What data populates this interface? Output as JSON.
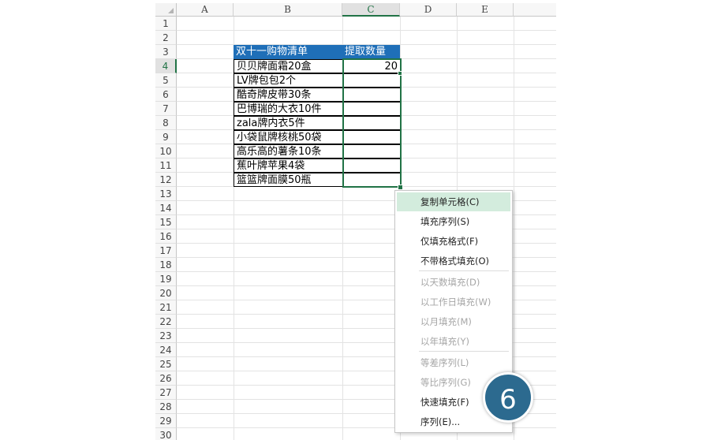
{
  "columns": [
    "A",
    "B",
    "C",
    "D",
    "E"
  ],
  "selected_column": "C",
  "selected_row": "4",
  "row_numbers": [
    "1",
    "2",
    "3",
    "4",
    "5",
    "6",
    "7",
    "8",
    "9",
    "10",
    "11",
    "12",
    "13",
    "14",
    "15",
    "16",
    "17",
    "18",
    "19",
    "20",
    "21",
    "22",
    "23",
    "24",
    "25",
    "26",
    "27",
    "28",
    "29",
    "30"
  ],
  "table": {
    "header_item": "双十一购物清单",
    "header_qty": "提取数量",
    "items": [
      {
        "name": "贝贝牌面霜20盒",
        "qty": "20"
      },
      {
        "name": "LV牌包包2个",
        "qty": ""
      },
      {
        "name": "酷奇牌皮带30条",
        "qty": ""
      },
      {
        "name": "巴博瑞的大衣10件",
        "qty": ""
      },
      {
        "name": "zala牌内衣5件",
        "qty": ""
      },
      {
        "name": "小袋鼠牌核桃50袋",
        "qty": ""
      },
      {
        "name": "高乐高的薯条10条",
        "qty": ""
      },
      {
        "name": "蕉叶牌苹果4袋",
        "qty": ""
      },
      {
        "name": "篮篮牌面膜50瓶",
        "qty": ""
      }
    ],
    "header_color": "#1f6fb8"
  },
  "context_menu": {
    "items": [
      {
        "label": "复制单元格(C)",
        "enabled": true,
        "highlighted": true
      },
      {
        "label": "填充序列(S)",
        "enabled": true
      },
      {
        "label": "仅填充格式(F)",
        "enabled": true
      },
      {
        "label": "不带格式填充(O)",
        "enabled": true
      },
      {
        "label": "以天数填充(D)",
        "enabled": false
      },
      {
        "label": "以工作日填充(W)",
        "enabled": false
      },
      {
        "label": "以月填充(M)",
        "enabled": false
      },
      {
        "label": "以年填充(Y)",
        "enabled": false
      },
      {
        "label": "等差序列(L)",
        "enabled": false
      },
      {
        "label": "等比序列(G)",
        "enabled": false
      },
      {
        "label": "快速填充(F)",
        "enabled": true
      },
      {
        "label": "序列(E)...",
        "enabled": true
      }
    ]
  },
  "step_badge": "6",
  "colors": {
    "selection": "#217346",
    "badge": "#2c6a8f",
    "menu_highlight": "#d3ecdd"
  }
}
